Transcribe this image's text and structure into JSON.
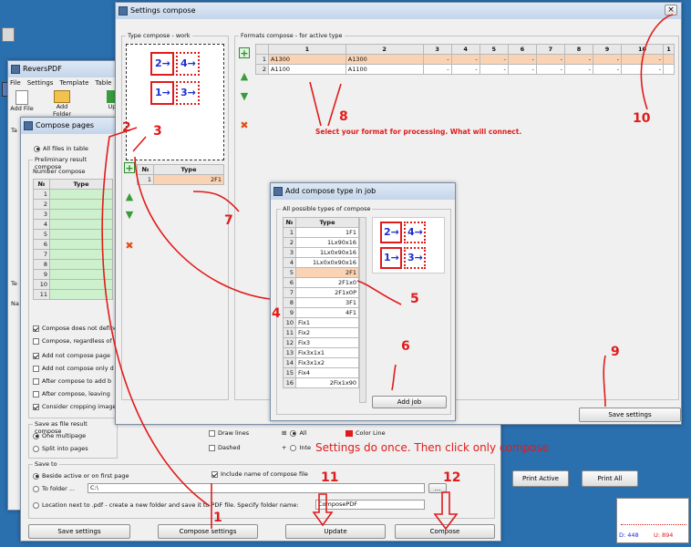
{
  "desktop": {
    "shortcuts": [
      {
        "label": ""
      },
      {
        "label": ""
      }
    ]
  },
  "main_window": {
    "title": "ReversPDF",
    "menu": [
      "File",
      "Settings",
      "Template",
      "Table"
    ],
    "toolbar": [
      {
        "label": "Add File"
      },
      {
        "label": "Add Folder"
      },
      {
        "label": "Up"
      }
    ],
    "side_labels": [
      "Ta",
      "Te",
      "Na"
    ]
  },
  "compose_pages": {
    "title": "Compose pages",
    "all_files": "All files in table",
    "preliminary_label": "Preliminary result compose",
    "number_compose_label": "Number compose",
    "table_headers": [
      "№",
      "Type"
    ],
    "table_rows": [
      "1",
      "2",
      "3",
      "4",
      "5",
      "6",
      "7",
      "8",
      "9",
      "10",
      "11"
    ],
    "options": [
      {
        "label": "Compose does not define",
        "checked": true
      },
      {
        "label": "Compose, regardless of",
        "checked": false
      },
      {
        "label": "Add not compose page",
        "checked": true
      },
      {
        "label": "Add not compose only d",
        "checked": false
      },
      {
        "label": "After compose to add b",
        "checked": false
      },
      {
        "label": "After compose, leaving",
        "checked": false
      },
      {
        "label": "Consider cropping image",
        "checked": true
      }
    ],
    "save_as_label": "Save as file result compose",
    "save_as_options": [
      {
        "label": "One multipage",
        "checked": true
      },
      {
        "label": "Split into pages",
        "checked": false
      }
    ],
    "draw_lines": "Draw lines",
    "dashed": "Dashed",
    "all": "All",
    "inte": "Inte",
    "color_line": "Color Line",
    "save_to_label": "Save to",
    "save_to_options": [
      {
        "label": "Beside active or on first page",
        "checked": true
      },
      {
        "label": "To folder ...",
        "checked": false
      },
      {
        "label": "Location next to .pdf - create a new folder and save it to PDF file. Specify folder name:",
        "checked": false
      }
    ],
    "folder_value": "C:\\",
    "folder_name_value": "ComposePDF",
    "include_name": "Include name of compose file",
    "print_active": "Print Active",
    "print_all": "Print All",
    "bottom_buttons": [
      "Save settings",
      "Compose settings",
      "Update",
      "Compose"
    ]
  },
  "settings_compose": {
    "title": "Settings compose",
    "type_work_label": "Type compose - work",
    "formats_label": "Formats compose - for active type",
    "type_table_headers": [
      "№",
      "Type"
    ],
    "type_table_rows": [
      {
        "n": "1",
        "type": "2F1"
      }
    ],
    "formats_columns": [
      "1",
      "2",
      "3",
      "4",
      "5",
      "6",
      "7",
      "8",
      "9",
      "10",
      "1"
    ],
    "formats_rows": [
      {
        "n": "1",
        "cells": [
          "A1300",
          "A1300",
          "-",
          "-",
          "-",
          "-",
          "-",
          "-",
          "-",
          "-"
        ]
      },
      {
        "n": "2",
        "cells": [
          "A1100",
          "A1100",
          "-",
          "-",
          "-",
          "-",
          "-",
          "-",
          "-",
          "-"
        ]
      }
    ],
    "save_settings": "Save settings",
    "close_symbol": "×"
  },
  "add_compose": {
    "title": "Add compose type in job",
    "group_label": "All possible types of compose",
    "headers": [
      "№",
      "Type"
    ],
    "rows": [
      {
        "n": "1",
        "type": "1F1"
      },
      {
        "n": "2",
        "type": "1Lx90x16"
      },
      {
        "n": "3",
        "type": "1Lx0x90x16"
      },
      {
        "n": "4",
        "type": "1Lx0x0x90x16"
      },
      {
        "n": "5",
        "type": "2F1"
      },
      {
        "n": "6",
        "type": "2F1x0"
      },
      {
        "n": "7",
        "type": "2F1x0P"
      },
      {
        "n": "8",
        "type": "3F1"
      },
      {
        "n": "9",
        "type": "4F1"
      },
      {
        "n": "10",
        "type": "Fix1"
      },
      {
        "n": "11",
        "type": "Fix2"
      },
      {
        "n": "12",
        "type": "Fix3"
      },
      {
        "n": "13",
        "type": "Fix3x1x1"
      },
      {
        "n": "14",
        "type": "Fix3x1x2"
      },
      {
        "n": "15",
        "type": "Fix4"
      },
      {
        "n": "16",
        "type": "2Fix1x90"
      }
    ],
    "selected_index": 5,
    "add_job": "Add job"
  },
  "layout_preview": {
    "tiles": [
      {
        "label": "2→"
      },
      {
        "label": "4→"
      },
      {
        "label": "1→"
      },
      {
        "label": "3→"
      }
    ]
  },
  "annotations": {
    "numbers": [
      "1",
      "2",
      "3",
      "4",
      "5",
      "6",
      "7",
      "8",
      "9",
      "10",
      "11",
      "12"
    ],
    "select_text": "Select your format for processing. What will connect.",
    "once_text": "Settings do once. Then click only compose"
  },
  "taskbar": {
    "d_label": "D: 448",
    "u_label": "U: 894"
  },
  "colors": {
    "annotation": "#e01b1b",
    "selected_row": "#fad3b4",
    "green_cell": "#cdf0cd",
    "tile_text": "#1b2fd0"
  }
}
